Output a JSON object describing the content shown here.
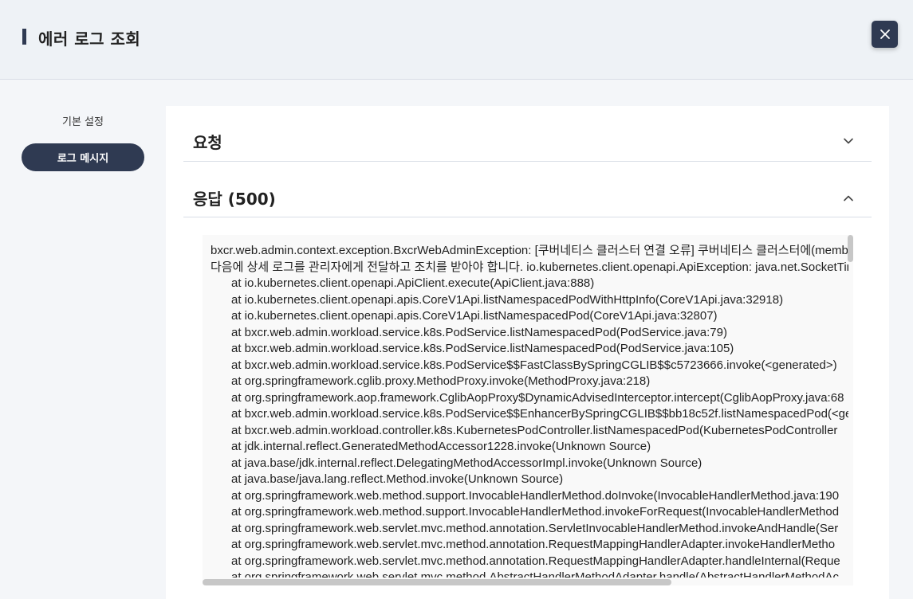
{
  "header": {
    "title": "에러 로그 조회",
    "close_icon": "close-icon"
  },
  "sidebar": {
    "items": [
      {
        "label": "기본 설정",
        "active": false
      },
      {
        "label": "로그 메시지",
        "active": true
      }
    ]
  },
  "sections": {
    "request": {
      "title": "요청",
      "expanded": false,
      "icon": "chevron-down-icon"
    },
    "response": {
      "title": "응답 (500)",
      "expanded": true,
      "icon": "chevron-up-icon"
    }
  },
  "log": {
    "lines": [
      "bxcr.web.admin.context.exception.BxcrWebAdminException: [쿠버네티스 클러스터 연결 오류] 쿠버네티스 클러스터에(member",
      "다음에 상세 로그를 관리자에게 전달하고 조치를 받아야 합니다. io.kubernetes.client.openapi.ApiException: java.net.SocketTime",
      "at io.kubernetes.client.openapi.ApiClient.execute(ApiClient.java:888)",
      "at io.kubernetes.client.openapi.apis.CoreV1Api.listNamespacedPodWithHttpInfo(CoreV1Api.java:32918)",
      "at io.kubernetes.client.openapi.apis.CoreV1Api.listNamespacedPod(CoreV1Api.java:32807)",
      "at bxcr.web.admin.workload.service.k8s.PodService.listNamespacedPod(PodService.java:79)",
      "at bxcr.web.admin.workload.service.k8s.PodService.listNamespacedPod(PodService.java:105)",
      "at bxcr.web.admin.workload.service.k8s.PodService$$FastClassBySpringCGLIB$$c5723666.invoke(<generated>)",
      "at org.springframework.cglib.proxy.MethodProxy.invoke(MethodProxy.java:218)",
      "at org.springframework.aop.framework.CglibAopProxy$DynamicAdvisedInterceptor.intercept(CglibAopProxy.java:68",
      "at bxcr.web.admin.workload.service.k8s.PodService$$EnhancerBySpringCGLIB$$bb18c52f.listNamespacedPod(<gen",
      "at bxcr.web.admin.workload.controller.k8s.KubernetesPodController.listNamespacedPod(KubernetesPodController",
      "at jdk.internal.reflect.GeneratedMethodAccessor1228.invoke(Unknown Source)",
      "at java.base/jdk.internal.reflect.DelegatingMethodAccessorImpl.invoke(Unknown Source)",
      "at java.base/java.lang.reflect.Method.invoke(Unknown Source)",
      "at org.springframework.web.method.support.InvocableHandlerMethod.doInvoke(InvocableHandlerMethod.java:190",
      "at org.springframework.web.method.support.InvocableHandlerMethod.invokeForRequest(InvocableHandlerMethod",
      "at org.springframework.web.servlet.mvc.method.annotation.ServletInvocableHandlerMethod.invokeAndHandle(Ser",
      "at org.springframework.web.servlet.mvc.method.annotation.RequestMappingHandlerAdapter.invokeHandlerMetho",
      "at org.springframework.web.servlet.mvc.method.annotation.RequestMappingHandlerAdapter.handleInternal(Reque",
      "at org.springframework.web.servlet.mvc.method.AbstractHandlerMethodAdapter.handle(AbstractHandlerMethodAc"
    ]
  },
  "colors": {
    "accent": "#2f3a52",
    "header_bg": "#eef2f6",
    "page_bg": "#f4f6f9",
    "panel_bg": "#ffffff",
    "log_bg": "#f9f9f9"
  }
}
